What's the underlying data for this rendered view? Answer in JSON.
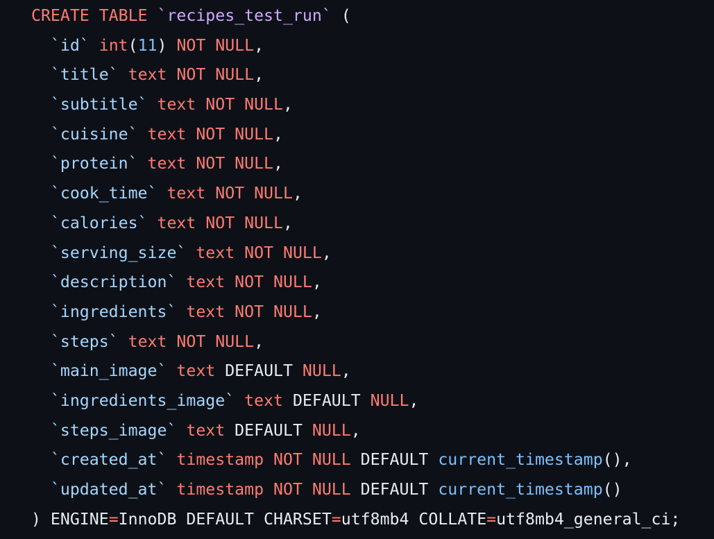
{
  "colors": {
    "background": "#0d1117",
    "keyword": "#ff7b72",
    "table_name": "#d2a8ff",
    "column_name": "#a5d6ff",
    "number": "#79c0ff",
    "function": "#79c0ff",
    "plain": "#e6edf3"
  },
  "lines": [
    [
      {
        "t": "CREATE TABLE ",
        "c": "kw"
      },
      {
        "t": "`recipes_test_run`",
        "c": "tbl"
      },
      {
        "t": " (",
        "c": "plain"
      }
    ],
    [
      {
        "t": "  ",
        "c": "plain"
      },
      {
        "t": "`id`",
        "c": "col"
      },
      {
        "t": " ",
        "c": "plain"
      },
      {
        "t": "int",
        "c": "kw"
      },
      {
        "t": "(",
        "c": "plain"
      },
      {
        "t": "11",
        "c": "num"
      },
      {
        "t": ") ",
        "c": "plain"
      },
      {
        "t": "NOT NULL",
        "c": "kw"
      },
      {
        "t": ",",
        "c": "plain"
      }
    ],
    [
      {
        "t": "  ",
        "c": "plain"
      },
      {
        "t": "`title`",
        "c": "col"
      },
      {
        "t": " ",
        "c": "plain"
      },
      {
        "t": "text NOT NULL",
        "c": "kw"
      },
      {
        "t": ",",
        "c": "plain"
      }
    ],
    [
      {
        "t": "  ",
        "c": "plain"
      },
      {
        "t": "`subtitle`",
        "c": "col"
      },
      {
        "t": " ",
        "c": "plain"
      },
      {
        "t": "text NOT NULL",
        "c": "kw"
      },
      {
        "t": ",",
        "c": "plain"
      }
    ],
    [
      {
        "t": "  ",
        "c": "plain"
      },
      {
        "t": "`cuisine`",
        "c": "col"
      },
      {
        "t": " ",
        "c": "plain"
      },
      {
        "t": "text NOT NULL",
        "c": "kw"
      },
      {
        "t": ",",
        "c": "plain"
      }
    ],
    [
      {
        "t": "  ",
        "c": "plain"
      },
      {
        "t": "`protein`",
        "c": "col"
      },
      {
        "t": " ",
        "c": "plain"
      },
      {
        "t": "text NOT NULL",
        "c": "kw"
      },
      {
        "t": ",",
        "c": "plain"
      }
    ],
    [
      {
        "t": "  ",
        "c": "plain"
      },
      {
        "t": "`cook_time`",
        "c": "col"
      },
      {
        "t": " ",
        "c": "plain"
      },
      {
        "t": "text NOT NULL",
        "c": "kw"
      },
      {
        "t": ",",
        "c": "plain"
      }
    ],
    [
      {
        "t": "  ",
        "c": "plain"
      },
      {
        "t": "`calories`",
        "c": "col"
      },
      {
        "t": " ",
        "c": "plain"
      },
      {
        "t": "text NOT NULL",
        "c": "kw"
      },
      {
        "t": ",",
        "c": "plain"
      }
    ],
    [
      {
        "t": "  ",
        "c": "plain"
      },
      {
        "t": "`serving_size`",
        "c": "col"
      },
      {
        "t": " ",
        "c": "plain"
      },
      {
        "t": "text NOT NULL",
        "c": "kw"
      },
      {
        "t": ",",
        "c": "plain"
      }
    ],
    [
      {
        "t": "  ",
        "c": "plain"
      },
      {
        "t": "`description`",
        "c": "col"
      },
      {
        "t": " ",
        "c": "plain"
      },
      {
        "t": "text NOT NULL",
        "c": "kw"
      },
      {
        "t": ",",
        "c": "plain"
      }
    ],
    [
      {
        "t": "  ",
        "c": "plain"
      },
      {
        "t": "`ingredients`",
        "c": "col"
      },
      {
        "t": " ",
        "c": "plain"
      },
      {
        "t": "text NOT NULL",
        "c": "kw"
      },
      {
        "t": ",",
        "c": "plain"
      }
    ],
    [
      {
        "t": "  ",
        "c": "plain"
      },
      {
        "t": "`steps`",
        "c": "col"
      },
      {
        "t": " ",
        "c": "plain"
      },
      {
        "t": "text NOT NULL",
        "c": "kw"
      },
      {
        "t": ",",
        "c": "plain"
      }
    ],
    [
      {
        "t": "  ",
        "c": "plain"
      },
      {
        "t": "`main_image`",
        "c": "col"
      },
      {
        "t": " ",
        "c": "plain"
      },
      {
        "t": "text",
        "c": "kw"
      },
      {
        "t": " DEFAULT ",
        "c": "plain"
      },
      {
        "t": "NULL",
        "c": "kw"
      },
      {
        "t": ",",
        "c": "plain"
      }
    ],
    [
      {
        "t": "  ",
        "c": "plain"
      },
      {
        "t": "`ingredients_image`",
        "c": "col"
      },
      {
        "t": " ",
        "c": "plain"
      },
      {
        "t": "text",
        "c": "kw"
      },
      {
        "t": " DEFAULT ",
        "c": "plain"
      },
      {
        "t": "NULL",
        "c": "kw"
      },
      {
        "t": ",",
        "c": "plain"
      }
    ],
    [
      {
        "t": "  ",
        "c": "plain"
      },
      {
        "t": "`steps_image`",
        "c": "col"
      },
      {
        "t": " ",
        "c": "plain"
      },
      {
        "t": "text",
        "c": "kw"
      },
      {
        "t": " DEFAULT ",
        "c": "plain"
      },
      {
        "t": "NULL",
        "c": "kw"
      },
      {
        "t": ",",
        "c": "plain"
      }
    ],
    [
      {
        "t": "  ",
        "c": "plain"
      },
      {
        "t": "`created_at`",
        "c": "col"
      },
      {
        "t": " ",
        "c": "plain"
      },
      {
        "t": "timestamp NOT NULL",
        "c": "kw"
      },
      {
        "t": " DEFAULT ",
        "c": "plain"
      },
      {
        "t": "current_timestamp",
        "c": "fn"
      },
      {
        "t": "(),",
        "c": "plain"
      }
    ],
    [
      {
        "t": "  ",
        "c": "plain"
      },
      {
        "t": "`updated_at`",
        "c": "col"
      },
      {
        "t": " ",
        "c": "plain"
      },
      {
        "t": "timestamp NOT NULL",
        "c": "kw"
      },
      {
        "t": " DEFAULT ",
        "c": "plain"
      },
      {
        "t": "current_timestamp",
        "c": "fn"
      },
      {
        "t": "()",
        "c": "plain"
      }
    ],
    [
      {
        "t": ") ENGINE",
        "c": "plain"
      },
      {
        "t": "=",
        "c": "kw"
      },
      {
        "t": "InnoDB DEFAULT CHARSET",
        "c": "plain"
      },
      {
        "t": "=",
        "c": "kw"
      },
      {
        "t": "utf8mb4 COLLATE",
        "c": "plain"
      },
      {
        "t": "=",
        "c": "kw"
      },
      {
        "t": "utf8mb4_general_ci;",
        "c": "plain"
      }
    ]
  ]
}
